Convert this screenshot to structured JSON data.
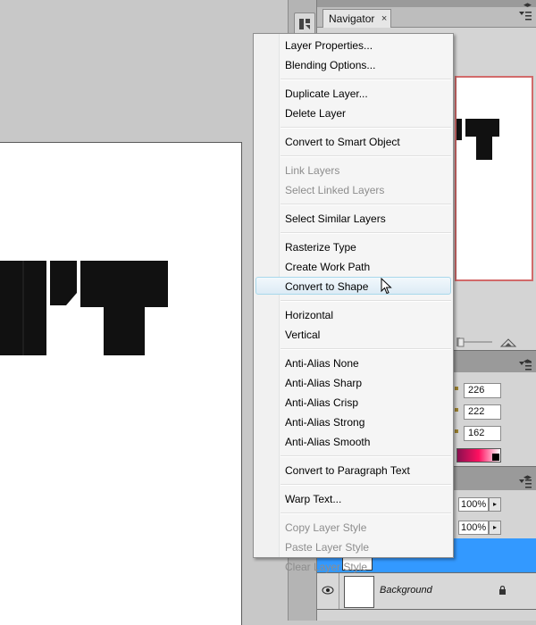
{
  "navigator": {
    "tab_label": "Navigator",
    "tab_close": "×"
  },
  "color_panel": {
    "values": [
      "226",
      "222",
      "162"
    ]
  },
  "layers_panel": {
    "opacity": "100%",
    "fill": "100%",
    "background_layer_name": "Background"
  },
  "context_menu": {
    "items": [
      {
        "label": "Layer Properties...",
        "disabled": false
      },
      {
        "label": "Blending Options...",
        "disabled": false
      },
      {
        "label": "Duplicate Layer...",
        "disabled": false
      },
      {
        "label": "Delete Layer",
        "disabled": false
      },
      {
        "label": "Convert to Smart Object",
        "disabled": false
      },
      {
        "label": "Link Layers",
        "disabled": true
      },
      {
        "label": "Select Linked Layers",
        "disabled": true
      },
      {
        "label": "Select Similar Layers",
        "disabled": false
      },
      {
        "label": "Rasterize Type",
        "disabled": false
      },
      {
        "label": "Create Work Path",
        "disabled": false
      },
      {
        "label": "Convert to Shape",
        "disabled": false,
        "hovered": true
      },
      {
        "label": "Horizontal",
        "disabled": false
      },
      {
        "label": "Vertical",
        "disabled": false
      },
      {
        "label": "Anti-Alias None",
        "disabled": false
      },
      {
        "label": "Anti-Alias Sharp",
        "disabled": false
      },
      {
        "label": "Anti-Alias Crisp",
        "disabled": false
      },
      {
        "label": "Anti-Alias Strong",
        "disabled": false
      },
      {
        "label": "Anti-Alias Smooth",
        "disabled": false
      },
      {
        "label": "Convert to Paragraph Text",
        "disabled": false
      },
      {
        "label": "Warp Text...",
        "disabled": false
      },
      {
        "label": "Copy Layer Style",
        "disabled": true
      },
      {
        "label": "Paste Layer Style",
        "disabled": true
      },
      {
        "label": "Clear Layer Style",
        "disabled": true
      }
    ]
  },
  "colors": {
    "selection": "#3399ff",
    "navigator_frame": "#d26a6a",
    "menu_hover_border": "#a8d8eb"
  },
  "icons": {
    "dock_tool": "history-brush-icon",
    "visibility": "eye-icon",
    "lock": "lock-icon",
    "pointer": "mouse-pointer-icon"
  }
}
